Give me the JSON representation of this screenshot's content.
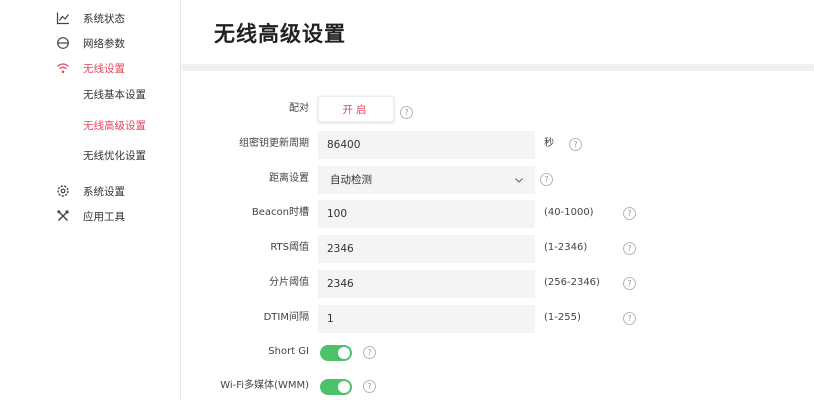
{
  "sidebar": {
    "items": [
      {
        "label": "系统状态",
        "icon": "line-chart-icon"
      },
      {
        "label": "网络参数",
        "icon": "globe-icon"
      },
      {
        "label": "无线设置",
        "icon": "wifi-icon"
      },
      {
        "label": "系统设置",
        "icon": "gear-icon"
      },
      {
        "label": "应用工具",
        "icon": "tools-icon"
      }
    ],
    "wireless_sub": [
      "无线基本设置",
      "无线高级设置",
      "无线优化设置"
    ]
  },
  "page": {
    "title": "无线高级设置"
  },
  "form": {
    "pair": {
      "label": "配对",
      "button": "开启"
    },
    "gtk_period": {
      "label": "组密钥更新周期",
      "value": "86400",
      "unit": "秒"
    },
    "distance": {
      "label": "距离设置",
      "selected": "自动检测"
    },
    "beacon": {
      "label": "Beacon时槽",
      "value": "100",
      "range": "(40-1000)"
    },
    "rts": {
      "label": "RTS阈值",
      "value": "2346",
      "range": "(1-2346)"
    },
    "frag": {
      "label": "分片阈值",
      "value": "2346",
      "range": "(256-2346)"
    },
    "dtim": {
      "label": "DTIM间隔",
      "value": "1",
      "range": "(1-255)"
    },
    "short_gi": {
      "label": "Short GI",
      "enabled": true
    },
    "wmm": {
      "label": "Wi-Fi多媒体(WMM)",
      "enabled": true
    }
  },
  "help_symbol": "?",
  "colors": {
    "accent": "#e8475c",
    "toggle_on": "#4cc36a",
    "field_bg": "#f4f4f4"
  }
}
